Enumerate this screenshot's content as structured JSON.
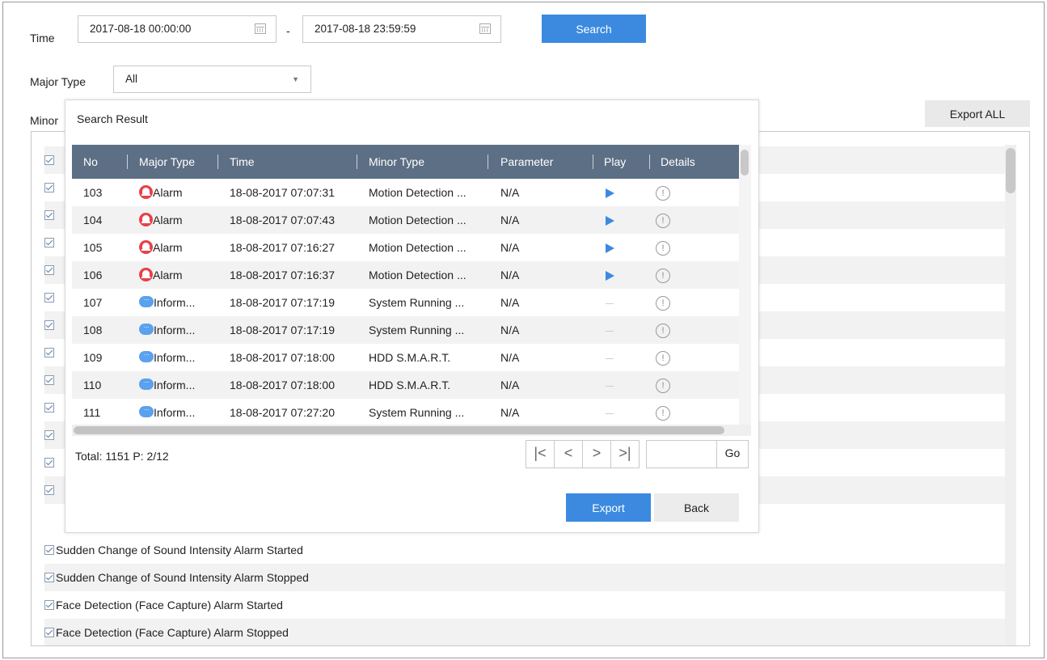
{
  "filters": {
    "time_label": "Time",
    "start_time": "2017-08-18 00:00:00",
    "end_time": "2017-08-18 23:59:59",
    "separator": "-",
    "search_label": "Search",
    "major_type_label": "Major Type",
    "major_type_value": "All",
    "minor_type_label": "Minor",
    "export_all_label": "Export ALL"
  },
  "outer_list": {
    "items": [
      "Sudden Change of Sound Intensity Alarm Started",
      "Sudden Change of Sound Intensity Alarm Stopped",
      "Face Detection (Face Capture) Alarm Started",
      "Face Detection (Face Capture) Alarm Stopped"
    ]
  },
  "dialog": {
    "title": "Search Result",
    "columns": [
      "No",
      "Major Type",
      "Time",
      "Minor Type",
      "Parameter",
      "Play",
      "Details"
    ],
    "rows": [
      {
        "no": "103",
        "major": "Alarm",
        "major_icon": "alarm-bell-icon",
        "time": "18-08-2017 07:07:31",
        "minor": "Motion Detection ...",
        "param": "N/A",
        "play": "play"
      },
      {
        "no": "104",
        "major": "Alarm",
        "major_icon": "alarm-bell-icon",
        "time": "18-08-2017 07:07:43",
        "minor": "Motion Detection ...",
        "param": "N/A",
        "play": "play"
      },
      {
        "no": "105",
        "major": "Alarm",
        "major_icon": "alarm-bell-icon",
        "time": "18-08-2017 07:16:27",
        "minor": "Motion Detection ...",
        "param": "N/A",
        "play": "play"
      },
      {
        "no": "106",
        "major": "Alarm",
        "major_icon": "alarm-bell-icon",
        "time": "18-08-2017 07:16:37",
        "minor": "Motion Detection ...",
        "param": "N/A",
        "play": "play"
      },
      {
        "no": "107",
        "major": "Inform...",
        "major_icon": "information-bubble-icon",
        "time": "18-08-2017 07:17:19",
        "minor": "System Running ...",
        "param": "N/A",
        "play": "none"
      },
      {
        "no": "108",
        "major": "Inform...",
        "major_icon": "information-bubble-icon",
        "time": "18-08-2017 07:17:19",
        "minor": "System Running ...",
        "param": "N/A",
        "play": "none"
      },
      {
        "no": "109",
        "major": "Inform...",
        "major_icon": "information-bubble-icon",
        "time": "18-08-2017 07:18:00",
        "minor": "HDD S.M.A.R.T.",
        "param": "N/A",
        "play": "none"
      },
      {
        "no": "110",
        "major": "Inform...",
        "major_icon": "information-bubble-icon",
        "time": "18-08-2017 07:18:00",
        "minor": "HDD S.M.A.R.T.",
        "param": "N/A",
        "play": "none"
      },
      {
        "no": "111",
        "major": "Inform...",
        "major_icon": "information-bubble-icon",
        "time": "18-08-2017 07:27:20",
        "minor": "System Running ...",
        "param": "N/A",
        "play": "none"
      }
    ],
    "total_text": "Total: 1151  P: 2/12",
    "pager": {
      "first": "|<",
      "prev": "<",
      "next": ">",
      "last": ">|",
      "page_input": "",
      "go": "Go"
    },
    "export_label": "Export",
    "back_label": "Back"
  },
  "colors": {
    "accent": "#3b8ae0",
    "header": "#5d6f85",
    "alarm": "#e8414a",
    "info": "#5aa1ee"
  }
}
